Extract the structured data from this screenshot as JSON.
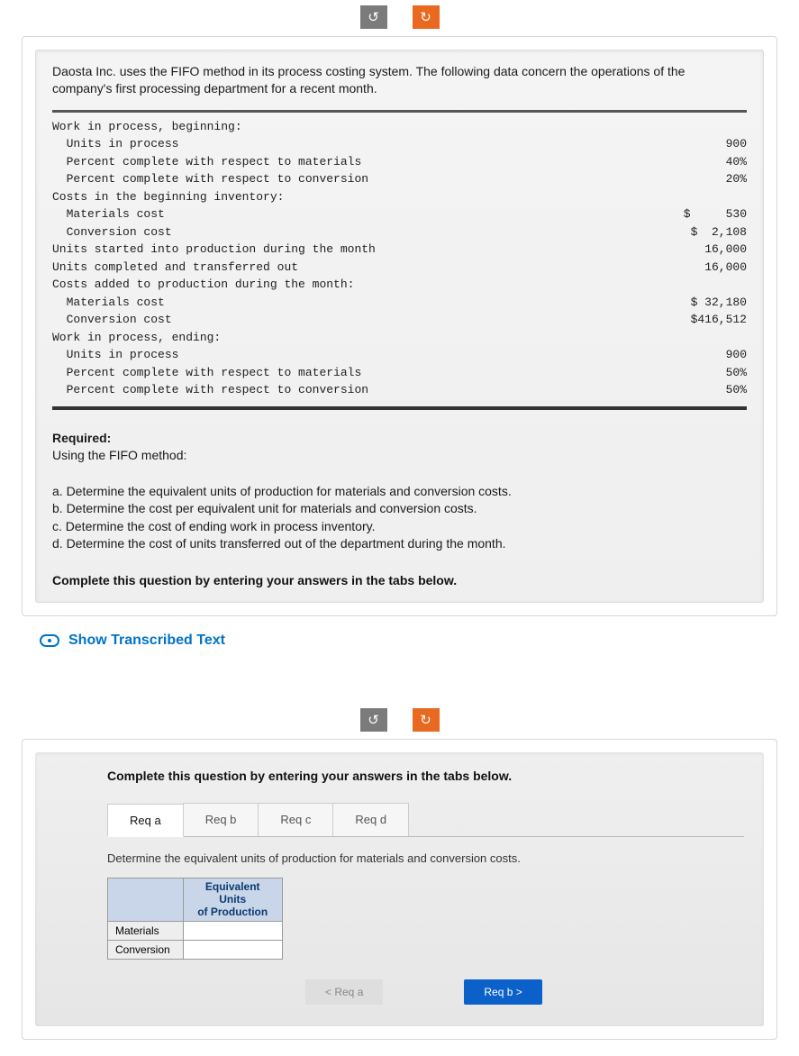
{
  "nav": {
    "back_glyph": "↺",
    "fwd_glyph": "↻"
  },
  "q1": {
    "intro": "Daosta Inc. uses the FIFO method in its process costing system. The following data concern the operations of the company's first processing department for a recent month.",
    "ledger": [
      {
        "lbl": "Work in process, beginning:",
        "val": ""
      },
      {
        "lbl": "  Units in process",
        "val": "900"
      },
      {
        "lbl": "  Percent complete with respect to materials",
        "val": "40%"
      },
      {
        "lbl": "  Percent complete with respect to conversion",
        "val": "20%"
      },
      {
        "lbl": "Costs in the beginning inventory:",
        "val": ""
      },
      {
        "lbl": "  Materials cost",
        "val": "$     530"
      },
      {
        "lbl": "  Conversion cost",
        "val": "$  2,108"
      },
      {
        "lbl": "Units started into production during the month",
        "val": "16,000"
      },
      {
        "lbl": "Units completed and transferred out",
        "val": "16,000"
      },
      {
        "lbl": "Costs added to production during the month:",
        "val": ""
      },
      {
        "lbl": "  Materials cost",
        "val": "$ 32,180"
      },
      {
        "lbl": "  Conversion cost",
        "val": "$416,512"
      },
      {
        "lbl": "Work in process, ending:",
        "val": ""
      },
      {
        "lbl": "  Units in process",
        "val": "900"
      },
      {
        "lbl": "  Percent complete with respect to materials",
        "val": "50%"
      },
      {
        "lbl": "  Percent complete with respect to conversion",
        "val": "50%"
      }
    ],
    "required_hdr": "Required:",
    "required_sub": "Using the FIFO method:",
    "required_items": [
      "a. Determine the equivalent units of production for materials and conversion costs.",
      "b. Determine the cost per equivalent unit for materials and conversion costs.",
      "c. Determine the cost of ending work in process inventory.",
      "d. Determine the cost of units transferred out of the department during the month."
    ],
    "prompt": "Complete this question by entering your answers in the tabs below."
  },
  "transcribe_label": "Show Transcribed Text",
  "q2": {
    "prompt": "Complete this question by entering your answers in the tabs below.",
    "tabs": [
      "Req a",
      "Req b",
      "Req c",
      "Req d"
    ],
    "active_tab": "Req a",
    "tab_desc": "Determine the equivalent units of production for materials and conversion costs.",
    "col_header_l1": "Equivalent Units",
    "col_header_l2": "of Production",
    "rows": [
      "Materials",
      "Conversion"
    ],
    "prev_btn": "<   Req a",
    "next_btn": "Req b   >"
  }
}
